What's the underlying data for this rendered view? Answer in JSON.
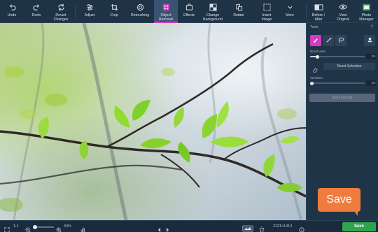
{
  "toolbar": {
    "items": [
      {
        "label": "Undo",
        "icon": "undo-icon"
      },
      {
        "label": "Redo",
        "icon": "redo-icon"
      },
      {
        "label": "Revert\nChanges",
        "icon": "revert-icon"
      },
      {
        "label": "Adjust",
        "icon": "sliders-icon"
      },
      {
        "label": "Crop",
        "icon": "crop-icon"
      },
      {
        "label": "Retouching",
        "icon": "retouch-icon"
      },
      {
        "label": "Object\nRemoval",
        "icon": "object-removal-icon",
        "active": true
      },
      {
        "label": "Effects",
        "icon": "effects-icon"
      },
      {
        "label": "Change\nBackground",
        "icon": "background-icon"
      },
      {
        "label": "Rotate",
        "icon": "rotate-icon"
      },
      {
        "label": "Insert\nImage",
        "icon": "insert-image-icon"
      },
      {
        "label": "More",
        "icon": "chevron-down-icon"
      },
      {
        "label": "Before /\nAfter",
        "icon": "before-after-icon"
      },
      {
        "label": "View\nOriginal",
        "icon": "eye-icon"
      },
      {
        "label": "Photo\nManager",
        "icon": "photo-manager-icon"
      }
    ],
    "accent_color": "#d23cbf"
  },
  "panel": {
    "title": "Tools",
    "help": "?",
    "brush_size_label": "Brush size:",
    "brush_size_value": "25",
    "brush_size_fraction": 0.14,
    "reset_label": "Reset Selection",
    "variation_label": "Variation:",
    "variation_value": "15",
    "variation_fraction": 0.0,
    "erase_label": "Start Erasing"
  },
  "status": {
    "fit_label": "1:1",
    "zoom_out": "−",
    "zoom_in": "+",
    "zoom_percent": "44%",
    "dimensions": "2121×1414",
    "save_label": "Save"
  },
  "callout": {
    "label": "Save",
    "color": "#f07b3f"
  },
  "colors": {
    "save_green": "#2ea44f"
  }
}
